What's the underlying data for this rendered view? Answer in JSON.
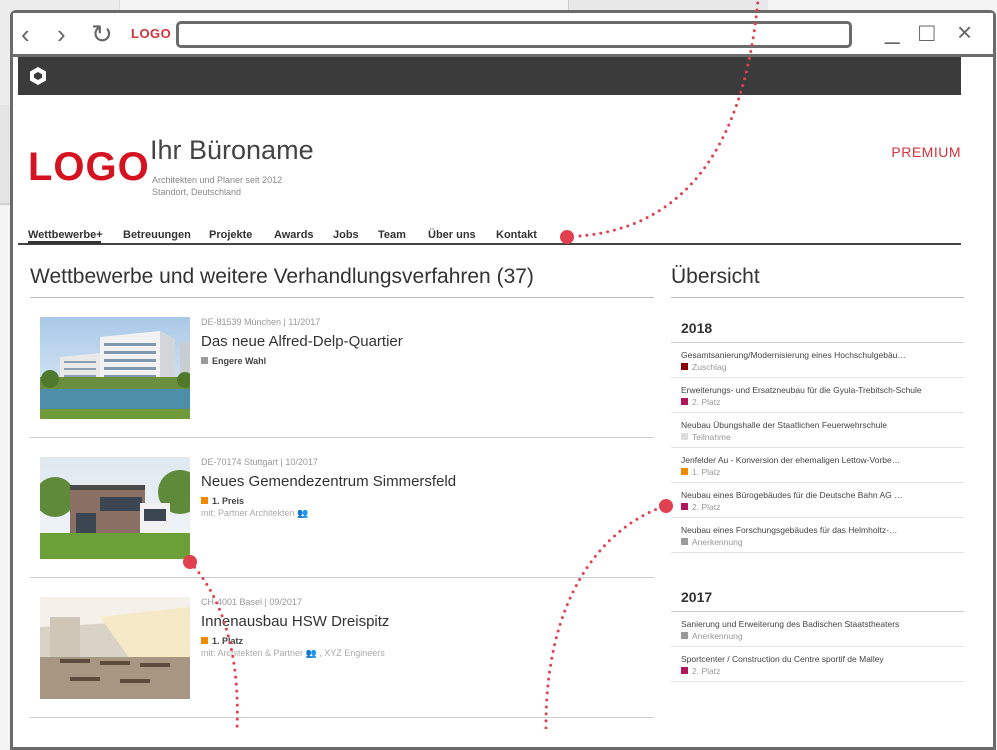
{
  "browser": {
    "back": "‹",
    "forward": "›",
    "reload": "↻",
    "logo": "LOGO",
    "minimize": "_",
    "maximize": "□",
    "close": "×"
  },
  "site": {
    "logo": "LOGO",
    "office_name": "Ihr Büroname",
    "tagline": "Architekten und Planer seit 2012",
    "location": "Standort, Deutschland",
    "premium": "PREMIUM"
  },
  "nav": [
    "Wettbewerbe+",
    "Betreuungen",
    "Projekte",
    "Awards",
    "Jobs",
    "Team",
    "Über uns",
    "Kontakt"
  ],
  "main": {
    "title": "Wettbewerbe und weitere Verhandlungsverfahren (37)",
    "entries": [
      {
        "loc": "DE-81539 München | 11/2017",
        "title": "Das neue Alfred-Delp-Quartier",
        "award": "Engere Wahl",
        "color": "#9a9a9a",
        "with": ""
      },
      {
        "loc": "DE-70174 Stuttgart | 10/2017",
        "title": "Neues Gemendezentrum Simmersfeld",
        "award": "1. Preis",
        "color": "#f08a00",
        "with": "mit: Partner Architekten 👥"
      },
      {
        "loc": "CH-4001 Basel | 09/2017",
        "title": "Innenausbau HSW Dreispitz",
        "award": "1. Platz",
        "color": "#f08a00",
        "with": "mit: Architekten & Partner 👥 , XYZ Engineers"
      }
    ]
  },
  "side": {
    "title": "Übersicht",
    "years": [
      {
        "year": "2018",
        "items": [
          {
            "t": "Gesamtsanierung/Modernisierung eines Hochschulgebäu…",
            "r": "Zuschlag",
            "c": "#8b0000"
          },
          {
            "t": "Erweiterungs- und Ersatzneubau für die Gyula-Trebitsch-Schule",
            "r": "2. Platz",
            "c": "#b0155a"
          },
          {
            "t": "Neubau Übungshalle der Staatlichen Feuerwehrschule",
            "r": "Teilnahme",
            "c": "#dddddd"
          },
          {
            "t": "Jenfelder Au - Konversion der ehemaligen Lettow-Vorbe…",
            "r": "1. Platz",
            "c": "#f08a00"
          },
          {
            "t": "Neubau eines Bürogebäudes für die Deutsche Bahn AG …",
            "r": "2. Platz",
            "c": "#b0155a"
          },
          {
            "t": "Neubau eines Forschungsgebäudes für das Helmholtz-…",
            "r": "Anerkennung",
            "c": "#9a9a9a"
          }
        ]
      },
      {
        "year": "2017",
        "items": [
          {
            "t": "Sanierung und Erweiterung des Badischen Staatstheaters",
            "r": "Anerkennung",
            "c": "#9a9a9a"
          },
          {
            "t": "Sportcenter / Construction du Centre sportif de Malley",
            "r": "2. Platz",
            "c": "#b0155a"
          }
        ]
      }
    ]
  },
  "colors": {
    "accent": "#d5121f",
    "annotation": "#e04050",
    "dark": "#3b3b3b"
  }
}
